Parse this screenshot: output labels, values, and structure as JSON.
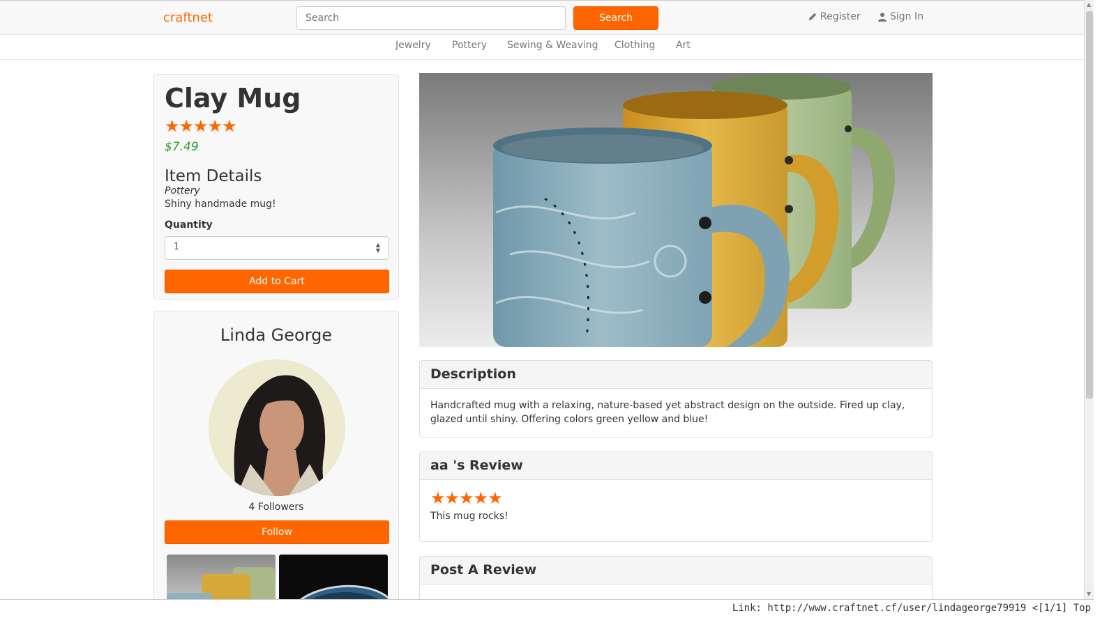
{
  "header": {
    "brand": "craftnet",
    "search_placeholder": "Search",
    "search_button": "Search",
    "register": "Register",
    "sign_in": "Sign In"
  },
  "categories": [
    "Jewelry",
    "Pottery",
    "Sewing & Weaving",
    "Clothing",
    "Art"
  ],
  "item": {
    "title": "Clay Mug",
    "rating_stars": "★★★★★",
    "rating": 5,
    "price": "$7.49",
    "details_heading": "Item Details",
    "category": "Pottery",
    "short_description": "Shiny handmade mug!",
    "quantity_label": "Quantity",
    "quantity_value": "1",
    "add_to_cart": "Add to Cart"
  },
  "seller": {
    "name": "Linda George",
    "followers": "4 Followers",
    "follow_button": "Follow"
  },
  "description": {
    "heading": "Description",
    "text": "Handcrafted mug with a relaxing, nature-based yet abstract design on the outside. Fired up clay, glazed until shiny. Offering colors green yellow and blue!"
  },
  "review": {
    "heading": "aa 's Review",
    "stars": "★★★★★",
    "rating": 5,
    "text": "This mug rocks!"
  },
  "post_review": {
    "heading": "Post A Review"
  },
  "status_bar": {
    "text": "Link: http://www.craftnet.cf/user/lindageorge79919 <[1/1] Top"
  },
  "colors": {
    "accent": "#ff6600",
    "price": "#2a9d2a"
  }
}
